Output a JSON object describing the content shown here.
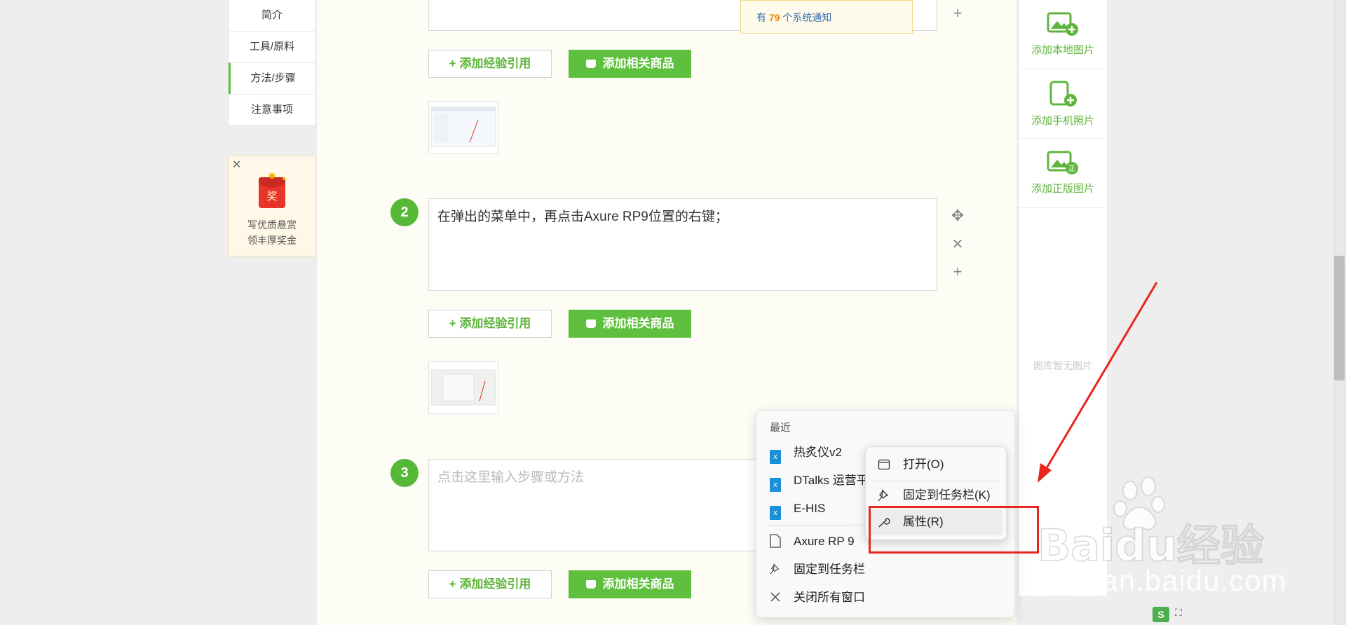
{
  "outline": {
    "items": [
      {
        "label": "简介"
      },
      {
        "label": "工具/原料"
      },
      {
        "label": "方法/步骤"
      },
      {
        "label": "注意事项"
      }
    ],
    "active_index": 2
  },
  "reward": {
    "line1": "写优质悬赏",
    "line2": "领丰厚奖金",
    "badge": "奖"
  },
  "notice": {
    "prefix": "有 ",
    "count": "79",
    "suffix": " 个系统通知"
  },
  "steps": [
    {
      "number": "2",
      "text": "在弹出的菜单中，再点击Axure RP9位置的右键；"
    },
    {
      "number": "3",
      "placeholder": "点击这里输入步骤或方法"
    }
  ],
  "buttons": {
    "add_reference": "+ 添加经验引用",
    "add_goods": "添加相关商品"
  },
  "image_panel": {
    "add_local": "添加本地图片",
    "add_phone": "添加手机照片",
    "add_licensed": "添加正版图片",
    "empty": "图库暂无图片"
  },
  "jump_list": {
    "header": "最近",
    "recent": [
      "热炙仪v2",
      "DTalks 运营平",
      "E-HIS"
    ],
    "app_name": "Axure RP 9",
    "pin": "固定到任务栏",
    "close_all": "关闭所有窗口"
  },
  "context_menu": {
    "open": "打开(O)",
    "pin": "固定到任务栏(K)",
    "properties": "属性(R)"
  },
  "watermark": {
    "brand": "Baidu经验",
    "url": "jingyan.baidu.com"
  },
  "colors": {
    "green": "#5fbf3e",
    "annotation_red": "#e8261d"
  }
}
